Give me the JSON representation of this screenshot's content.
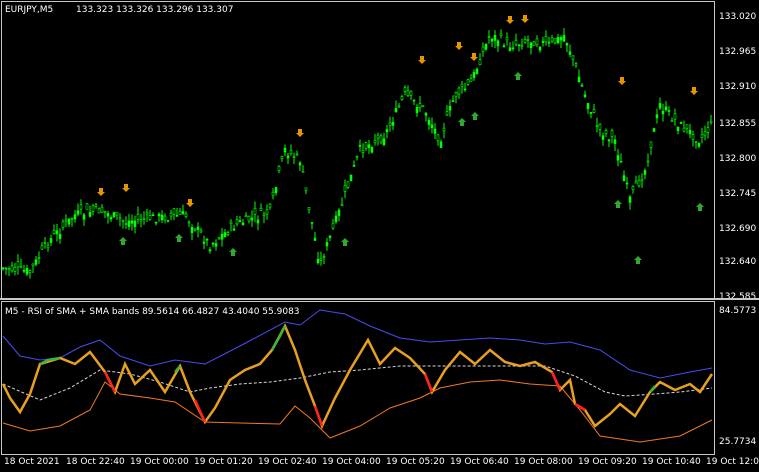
{
  "main_chart": {
    "symbol_label": "EURJPY,M5",
    "ohlc_label": "133.323 133.326 133.296 133.307",
    "price_axis": [
      "133.020",
      "132.965",
      "132.910",
      "132.855",
      "132.800",
      "132.745",
      "132.690",
      "132.640",
      "132.585"
    ],
    "colors": {
      "bull": "#00ff00",
      "bear": "#00ff00",
      "fractal_up": "#e69500",
      "fractal_down": "#2eaa2e"
    }
  },
  "indicator": {
    "label": "M5 - RSI of SMA + SMA bands 89.5614 66.4827 43.4040 55.9083",
    "max_label": "84.5773",
    "min_label": "25.7734",
    "colors": {
      "upper_band": "#4a4af0",
      "lower_band": "#f07820",
      "mid": "#d8d8d8",
      "rsi": "#e8a020",
      "rsi_up": "#3cb43c",
      "rsi_down": "#ff2020"
    }
  },
  "time_axis": [
    "18 Oct 2021",
    "18 Oct 22:40",
    "19 Oct 00:00",
    "19 Oct 01:20",
    "19 Oct 02:40",
    "19 Oct 04:00",
    "19 Oct 05:20",
    "19 Oct 06:40",
    "19 Oct 08:00",
    "19 Oct 09:20",
    "19 Oct 10:40",
    "19 Oct 12:00"
  ]
}
